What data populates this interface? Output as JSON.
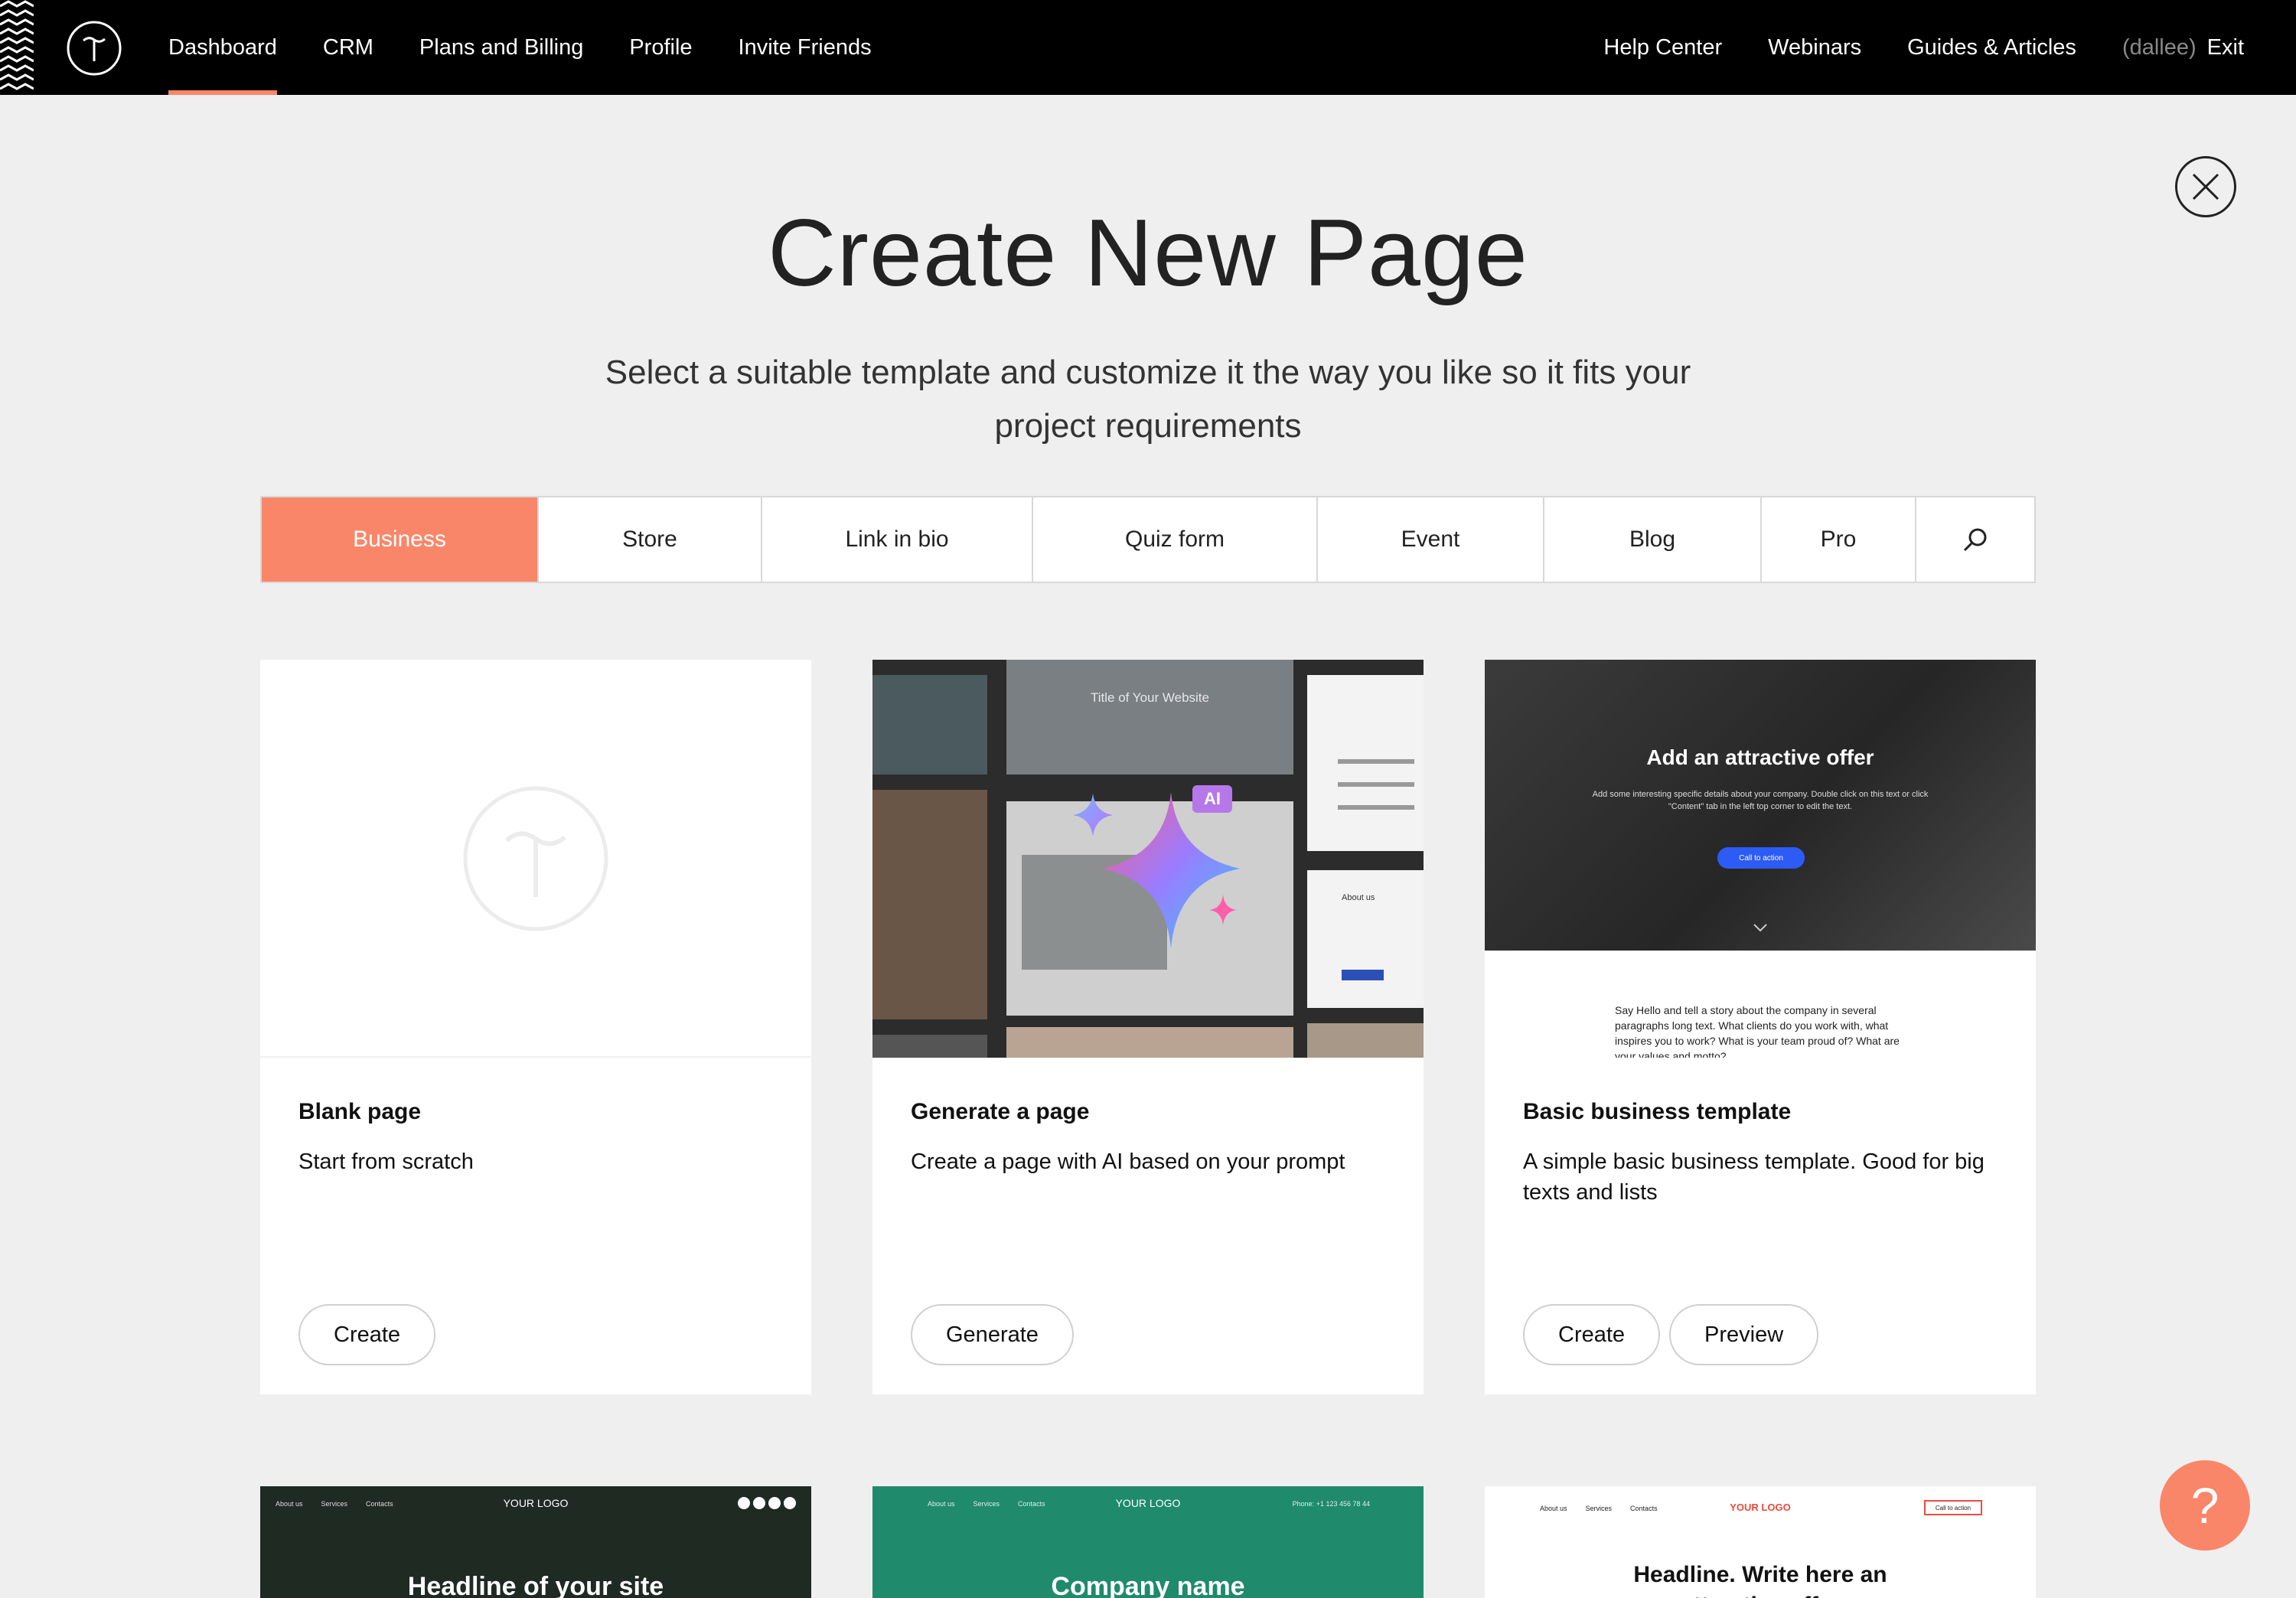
{
  "nav": {
    "left": [
      {
        "label": "Dashboard",
        "active": true
      },
      {
        "label": "CRM"
      },
      {
        "label": "Plans and Billing"
      },
      {
        "label": "Profile"
      },
      {
        "label": "Invite Friends"
      }
    ],
    "right": [
      {
        "label": "Help Center"
      },
      {
        "label": "Webinars"
      },
      {
        "label": "Guides & Articles"
      }
    ],
    "user": "(dallee)",
    "exit": "Exit"
  },
  "header": {
    "title": "Create New Page",
    "subtitle": "Select a suitable template and customize it the way you like so it fits your project requirements"
  },
  "tabs": [
    {
      "label": "Business",
      "active": true
    },
    {
      "label": "Store"
    },
    {
      "label": "Link in bio"
    },
    {
      "label": "Quiz form"
    },
    {
      "label": "Event"
    },
    {
      "label": "Blog"
    },
    {
      "label": "Pro"
    }
  ],
  "cards": [
    {
      "title": "Blank page",
      "desc": "Start from scratch",
      "buttons": [
        "Create"
      ]
    },
    {
      "title": "Generate a page",
      "desc": "Create a page with AI based on your prompt",
      "buttons": [
        "Generate"
      ],
      "preview": {
        "site_title": "Title of Your Website",
        "badge": "AI",
        "about": "About us"
      }
    },
    {
      "title": "Basic business template",
      "desc": "A simple basic business template. Good for big texts and lists",
      "buttons": [
        "Create",
        "Preview"
      ],
      "preview": {
        "headline": "Add an attractive offer",
        "body": "Add some interesting specific details about your company. Double click on this text or click \"Content\" tab in the left top corner to edit the text.",
        "cta": "Call to action",
        "story": "Say Hello and tell a story about the company in several paragraphs long text. What clients do you work with, what inspires you to work? What is your team proud of? What are your values and motto?"
      }
    }
  ],
  "bottom_cards": [
    {
      "logo": "YOUR LOGO",
      "headline": "Headline of your site",
      "nav": [
        "About us",
        "Services",
        "Contacts"
      ]
    },
    {
      "logo": "YOUR LOGO",
      "headline": "Company name",
      "nav": [
        "About us",
        "Services",
        "Contacts"
      ],
      "phone": "Phone: +1 123 456 78 44"
    },
    {
      "logo": "YOUR LOGO",
      "headline": "Headline. Write here an attractive offer",
      "nav": [
        "About us",
        "Services",
        "Contacts"
      ],
      "cta": "Call to action"
    }
  ],
  "help": "?",
  "colors": {
    "accent": "#fa8669",
    "topbar": "#000000",
    "background": "#efefef"
  }
}
